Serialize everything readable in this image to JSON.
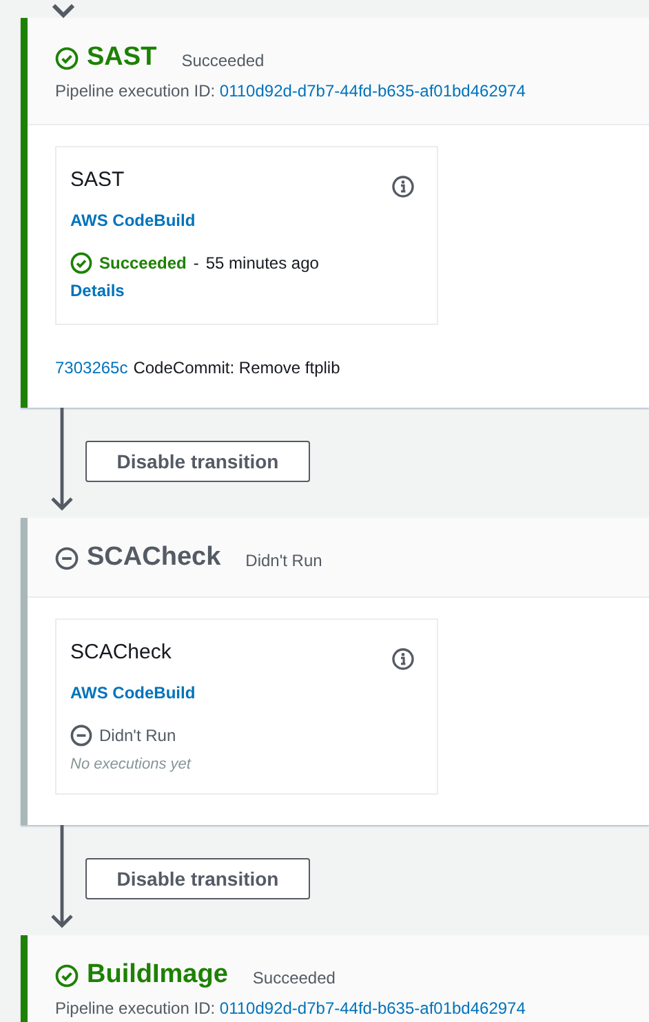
{
  "stages": [
    {
      "name": "SAST",
      "kind": "succeeded",
      "status_label": "Succeeded",
      "execution_id_label": "Pipeline execution ID:",
      "execution_id": "0110d92d-d7b7-44fd-b635-af01bd462974",
      "actions": [
        {
          "name": "SAST",
          "provider": "AWS CodeBuild",
          "kind": "succeeded",
          "status_label": "Succeeded",
          "separator": "-",
          "time": "55 minutes ago",
          "link": "Details"
        }
      ],
      "commit": {
        "id": "7303265c",
        "message": "CodeCommit: Remove ftplib"
      }
    },
    {
      "name": "SCACheck",
      "kind": "didnt_run",
      "status_label": "Didn't Run",
      "actions": [
        {
          "name": "SCACheck",
          "provider": "AWS CodeBuild",
          "kind": "didnt_run",
          "status_label": "Didn't Run",
          "note": "No executions yet"
        }
      ]
    },
    {
      "name": "BuildImage",
      "kind": "succeeded",
      "status_label": "Succeeded",
      "execution_id_label": "Pipeline execution ID:",
      "execution_id": "0110d92d-d7b7-44fd-b635-af01bd462974"
    }
  ],
  "transitions": [
    {
      "button": "Disable transition"
    },
    {
      "button": "Disable transition"
    }
  ]
}
